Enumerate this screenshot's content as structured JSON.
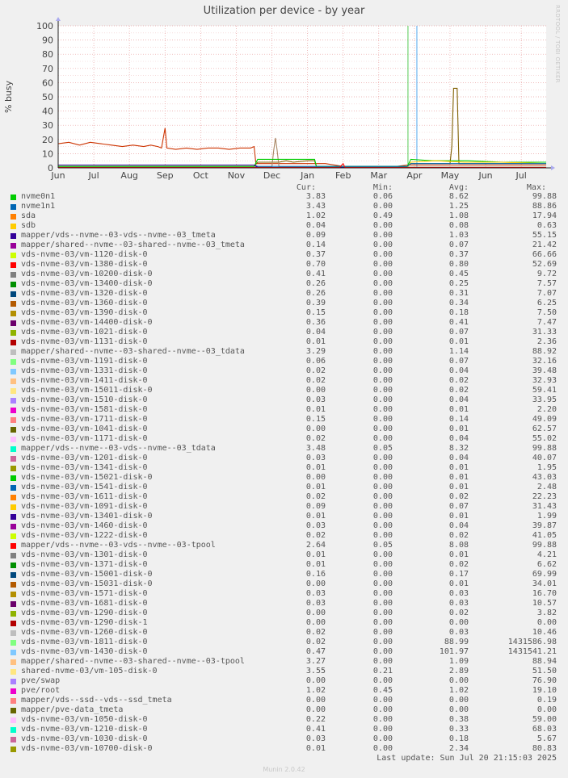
{
  "title": "Utilization per device - by year",
  "watermark": "RRDTOOL / TOBI OETIKER",
  "footer": "Munin 2.0.42",
  "last_update": "Last update: Sun Jul 20 21:15:03 2025",
  "columns": [
    "Cur:",
    "Min:",
    "Avg:",
    "Max:"
  ],
  "chart_data": {
    "type": "line",
    "title": "Utilization per device - by year",
    "ylabel": "% busy",
    "ylim": [
      0,
      100
    ],
    "yticks": [
      0,
      10,
      20,
      30,
      40,
      50,
      60,
      70,
      80,
      90,
      100
    ],
    "xticks": [
      "Jun",
      "Jul",
      "Aug",
      "Sep",
      "Oct",
      "Nov",
      "Dec",
      "Jan",
      "Feb",
      "Mar",
      "Apr",
      "May",
      "Jun",
      "Jul"
    ],
    "xrange": [
      0,
      13.7
    ],
    "grid": true,
    "vlines": [
      {
        "x": 9.82,
        "color": "#55cc55"
      },
      {
        "x": 10.07,
        "color": "#55aaee"
      }
    ],
    "series": [
      {
        "name": "mapper/vds--nvme--03-vds--nvme--03_tdata",
        "color": "#cc3300",
        "points": [
          [
            0,
            17
          ],
          [
            0.3,
            18
          ],
          [
            0.6,
            16
          ],
          [
            0.9,
            18
          ],
          [
            1.2,
            17
          ],
          [
            1.5,
            16
          ],
          [
            1.8,
            15
          ],
          [
            2.1,
            16
          ],
          [
            2.4,
            15
          ],
          [
            2.6,
            16
          ],
          [
            2.8,
            15
          ],
          [
            2.9,
            14
          ],
          [
            3.0,
            28
          ],
          [
            3.05,
            14
          ],
          [
            3.3,
            13
          ],
          [
            3.6,
            14
          ],
          [
            3.9,
            13
          ],
          [
            4.2,
            14
          ],
          [
            4.5,
            14
          ],
          [
            4.8,
            13
          ],
          [
            5.1,
            14
          ],
          [
            5.4,
            14
          ],
          [
            5.5,
            15
          ],
          [
            5.55,
            3
          ],
          [
            6.5,
            3
          ],
          [
            7.5,
            3
          ],
          [
            8.0,
            1
          ],
          [
            9.5,
            1
          ],
          [
            9.8,
            2
          ],
          [
            10.5,
            2
          ],
          [
            11.0,
            2
          ],
          [
            12.0,
            2
          ],
          [
            13.0,
            2
          ],
          [
            13.7,
            2
          ]
        ]
      },
      {
        "name": "mapper/vds--nvme--03-vds--nvme--03-tpool",
        "color": "#7f5f00",
        "points": [
          [
            0,
            1
          ],
          [
            5.5,
            1
          ],
          [
            5.6,
            4
          ],
          [
            6.0,
            4
          ],
          [
            6.2,
            4
          ],
          [
            6.4,
            5
          ],
          [
            6.6,
            4
          ],
          [
            7.0,
            5
          ],
          [
            7.2,
            5
          ],
          [
            7.25,
            1
          ],
          [
            9.8,
            1
          ],
          [
            9.9,
            3
          ],
          [
            10.3,
            3
          ],
          [
            11.0,
            3
          ],
          [
            11.05,
            15
          ],
          [
            11.1,
            56
          ],
          [
            11.2,
            56
          ],
          [
            11.25,
            3
          ],
          [
            12.0,
            3
          ],
          [
            13.7,
            3
          ]
        ]
      },
      {
        "name": "mapper/shared--nvme--03-shared--nvme--03_tdata",
        "color": "#aa8866",
        "points": [
          [
            0,
            0.5
          ],
          [
            6.0,
            0.5
          ],
          [
            6.05,
            12
          ],
          [
            6.1,
            21
          ],
          [
            6.15,
            12
          ],
          [
            6.2,
            0.5
          ],
          [
            13.7,
            0.5
          ]
        ]
      },
      {
        "name": "nvme0n1",
        "color": "#00cc00",
        "points": [
          [
            0,
            1
          ],
          [
            5.5,
            1
          ],
          [
            5.6,
            6
          ],
          [
            7.2,
            6
          ],
          [
            7.25,
            1
          ],
          [
            9.8,
            1
          ],
          [
            9.9,
            6
          ],
          [
            10.5,
            5
          ],
          [
            11.5,
            5
          ],
          [
            12.5,
            4
          ],
          [
            13.7,
            4
          ]
        ]
      },
      {
        "name": "sdb",
        "color": "#ffcc00",
        "points": [
          [
            0,
            0.3
          ],
          [
            9.8,
            0.3
          ],
          [
            9.9,
            4
          ],
          [
            10.6,
            5
          ],
          [
            11.4,
            4
          ],
          [
            12.4,
            4
          ],
          [
            13.7,
            3
          ]
        ]
      },
      {
        "name": "nvme1n1",
        "color": "#0066b3",
        "points": [
          [
            0,
            2
          ],
          [
            5.5,
            2
          ],
          [
            5.6,
            1
          ],
          [
            9.8,
            1
          ],
          [
            9.9,
            3
          ],
          [
            13.7,
            3
          ]
        ]
      },
      {
        "name": "mapper/vds--nvme--03-vds--nvme--03_tmeta",
        "color": "#330099",
        "points": [
          [
            0,
            2
          ],
          [
            1.5,
            2
          ],
          [
            3.0,
            2
          ],
          [
            4.5,
            2
          ],
          [
            5.5,
            2
          ],
          [
            5.6,
            0.3
          ],
          [
            13.7,
            0.3
          ]
        ]
      },
      {
        "name": "vds-nvme-03/vm-1380-disk-0",
        "color": "#ff0000",
        "points": [
          [
            0,
            0.3
          ],
          [
            7.9,
            0.3
          ],
          [
            8.0,
            3
          ],
          [
            8.05,
            0.3
          ],
          [
            13.7,
            0.3
          ]
        ]
      }
    ]
  },
  "legend": [
    {
      "name": "nvme0n1",
      "color": "#00cc00",
      "cur": "3.83",
      "min": "0.06",
      "avg": "8.62",
      "max": "99.88"
    },
    {
      "name": "nvme1n1",
      "color": "#0066b3",
      "cur": "3.43",
      "min": "0.00",
      "avg": "1.25",
      "max": "88.86"
    },
    {
      "name": "sda",
      "color": "#ff8000",
      "cur": "1.02",
      "min": "0.49",
      "avg": "1.08",
      "max": "17.94"
    },
    {
      "name": "sdb",
      "color": "#ffcc00",
      "cur": "0.04",
      "min": "0.00",
      "avg": "0.08",
      "max": "0.63"
    },
    {
      "name": "mapper/vds--nvme--03-vds--nvme--03_tmeta",
      "color": "#330099",
      "cur": "0.09",
      "min": "0.00",
      "avg": "1.03",
      "max": "55.15"
    },
    {
      "name": "mapper/shared--nvme--03-shared--nvme--03_tmeta",
      "color": "#990099",
      "cur": "0.14",
      "min": "0.00",
      "avg": "0.07",
      "max": "21.42"
    },
    {
      "name": "vds-nvme-03/vm-1120-disk-0",
      "color": "#ccff00",
      "cur": "0.37",
      "min": "0.00",
      "avg": "0.37",
      "max": "66.66"
    },
    {
      "name": "vds-nvme-03/vm-1380-disk-0",
      "color": "#ff0000",
      "cur": "0.70",
      "min": "0.00",
      "avg": "0.80",
      "max": "52.69"
    },
    {
      "name": "vds-nvme-03/vm-10200-disk-0",
      "color": "#808080",
      "cur": "0.41",
      "min": "0.00",
      "avg": "0.45",
      "max": "9.72"
    },
    {
      "name": "vds-nvme-03/vm-13400-disk-0",
      "color": "#008f00",
      "cur": "0.26",
      "min": "0.00",
      "avg": "0.25",
      "max": "7.57"
    },
    {
      "name": "vds-nvme-03/vm-1320-disk-0",
      "color": "#00487d",
      "cur": "0.26",
      "min": "0.00",
      "avg": "0.31",
      "max": "7.07"
    },
    {
      "name": "vds-nvme-03/vm-1360-disk-0",
      "color": "#b35a00",
      "cur": "0.39",
      "min": "0.00",
      "avg": "0.34",
      "max": "6.25"
    },
    {
      "name": "vds-nvme-03/vm-1390-disk-0",
      "color": "#b38f00",
      "cur": "0.15",
      "min": "0.00",
      "avg": "0.18",
      "max": "7.50"
    },
    {
      "name": "vds-nvme-03/vm-14400-disk-0",
      "color": "#6b006b",
      "cur": "0.36",
      "min": "0.00",
      "avg": "0.41",
      "max": "7.47"
    },
    {
      "name": "vds-nvme-03/vm-1021-disk-0",
      "color": "#8fb300",
      "cur": "0.04",
      "min": "0.00",
      "avg": "0.07",
      "max": "31.33"
    },
    {
      "name": "vds-nvme-03/vm-1131-disk-0",
      "color": "#b30000",
      "cur": "0.01",
      "min": "0.00",
      "avg": "0.01",
      "max": "2.36"
    },
    {
      "name": "mapper/shared--nvme--03-shared--nvme--03_tdata",
      "color": "#bebebe",
      "cur": "3.29",
      "min": "0.00",
      "avg": "1.14",
      "max": "88.92"
    },
    {
      "name": "vds-nvme-03/vm-1191-disk-0",
      "color": "#80ff80",
      "cur": "0.06",
      "min": "0.00",
      "avg": "0.07",
      "max": "32.16"
    },
    {
      "name": "vds-nvme-03/vm-1331-disk-0",
      "color": "#80c9ff",
      "cur": "0.02",
      "min": "0.00",
      "avg": "0.04",
      "max": "39.48"
    },
    {
      "name": "vds-nvme-03/vm-1411-disk-0",
      "color": "#ffc080",
      "cur": "0.02",
      "min": "0.00",
      "avg": "0.02",
      "max": "32.93"
    },
    {
      "name": "vds-nvme-03/vm-15011-disk-0",
      "color": "#ffe680",
      "cur": "0.00",
      "min": "0.00",
      "avg": "0.02",
      "max": "59.41"
    },
    {
      "name": "vds-nvme-03/vm-1510-disk-0",
      "color": "#aa80ff",
      "cur": "0.03",
      "min": "0.00",
      "avg": "0.04",
      "max": "33.95"
    },
    {
      "name": "vds-nvme-03/vm-1581-disk-0",
      "color": "#ee00cc",
      "cur": "0.01",
      "min": "0.00",
      "avg": "0.01",
      "max": "2.20"
    },
    {
      "name": "vds-nvme-03/vm-1711-disk-0",
      "color": "#ff8080",
      "cur": "0.15",
      "min": "0.00",
      "avg": "0.14",
      "max": "49.09"
    },
    {
      "name": "vds-nvme-03/vm-1041-disk-0",
      "color": "#666600",
      "cur": "0.00",
      "min": "0.00",
      "avg": "0.01",
      "max": "62.57"
    },
    {
      "name": "vds-nvme-03/vm-1171-disk-0",
      "color": "#ffbfff",
      "cur": "0.02",
      "min": "0.00",
      "avg": "0.04",
      "max": "55.02"
    },
    {
      "name": "mapper/vds--nvme--03-vds--nvme--03_tdata",
      "color": "#00ffcc",
      "cur": "3.48",
      "min": "0.05",
      "avg": "8.32",
      "max": "99.88"
    },
    {
      "name": "vds-nvme-03/vm-1201-disk-0",
      "color": "#cc6699",
      "cur": "0.03",
      "min": "0.00",
      "avg": "0.04",
      "max": "40.07"
    },
    {
      "name": "vds-nvme-03/vm-1341-disk-0",
      "color": "#999900",
      "cur": "0.01",
      "min": "0.00",
      "avg": "0.01",
      "max": "1.95"
    },
    {
      "name": "vds-nvme-03/vm-15021-disk-0",
      "color": "#00cc00",
      "cur": "0.00",
      "min": "0.00",
      "avg": "0.01",
      "max": "43.03"
    },
    {
      "name": "vds-nvme-03/vm-1541-disk-0",
      "color": "#0066b3",
      "cur": "0.01",
      "min": "0.00",
      "avg": "0.01",
      "max": "2.48"
    },
    {
      "name": "vds-nvme-03/vm-1611-disk-0",
      "color": "#ff8000",
      "cur": "0.02",
      "min": "0.00",
      "avg": "0.02",
      "max": "22.23"
    },
    {
      "name": "vds-nvme-03/vm-1091-disk-0",
      "color": "#ffcc00",
      "cur": "0.09",
      "min": "0.00",
      "avg": "0.07",
      "max": "31.43"
    },
    {
      "name": "vds-nvme-03/vm-13401-disk-0",
      "color": "#330099",
      "cur": "0.01",
      "min": "0.00",
      "avg": "0.01",
      "max": "1.99"
    },
    {
      "name": "vds-nvme-03/vm-1460-disk-0",
      "color": "#990099",
      "cur": "0.03",
      "min": "0.00",
      "avg": "0.04",
      "max": "39.87"
    },
    {
      "name": "vds-nvme-03/vm-1222-disk-0",
      "color": "#ccff00",
      "cur": "0.02",
      "min": "0.00",
      "avg": "0.02",
      "max": "41.05"
    },
    {
      "name": "mapper/vds--nvme--03-vds--nvme--03-tpool",
      "color": "#ff0000",
      "cur": "2.64",
      "min": "0.05",
      "avg": "8.08",
      "max": "99.88"
    },
    {
      "name": "vds-nvme-03/vm-1301-disk-0",
      "color": "#808080",
      "cur": "0.01",
      "min": "0.00",
      "avg": "0.01",
      "max": "4.21"
    },
    {
      "name": "vds-nvme-03/vm-1371-disk-0",
      "color": "#008f00",
      "cur": "0.01",
      "min": "0.00",
      "avg": "0.02",
      "max": "6.62"
    },
    {
      "name": "vds-nvme-03/vm-15001-disk-0",
      "color": "#00487d",
      "cur": "0.16",
      "min": "0.00",
      "avg": "0.17",
      "max": "69.99"
    },
    {
      "name": "vds-nvme-03/vm-15031-disk-0",
      "color": "#b35a00",
      "cur": "0.00",
      "min": "0.00",
      "avg": "0.01",
      "max": "34.01"
    },
    {
      "name": "vds-nvme-03/vm-1571-disk-0",
      "color": "#b38f00",
      "cur": "0.03",
      "min": "0.00",
      "avg": "0.03",
      "max": "16.70"
    },
    {
      "name": "vds-nvme-03/vm-1681-disk-0",
      "color": "#6b006b",
      "cur": "0.03",
      "min": "0.00",
      "avg": "0.03",
      "max": "10.57"
    },
    {
      "name": "vds-nvme-03/vm-1290-disk-0",
      "color": "#8fb300",
      "cur": "0.00",
      "min": "0.00",
      "avg": "0.02",
      "max": "3.82"
    },
    {
      "name": "vds-nvme-03/vm-1290-disk-1",
      "color": "#b30000",
      "cur": "0.00",
      "min": "0.00",
      "avg": "0.00",
      "max": "0.00"
    },
    {
      "name": "vds-nvme-03/vm-1260-disk-0",
      "color": "#bebebe",
      "cur": "0.02",
      "min": "0.00",
      "avg": "0.03",
      "max": "10.46"
    },
    {
      "name": "vds-nvme-03/vm-1811-disk-0",
      "color": "#80ff80",
      "cur": "0.02",
      "min": "0.00",
      "avg": "88.99",
      "max": "1431586.98"
    },
    {
      "name": "vds-nvme-03/vm-1430-disk-0",
      "color": "#80c9ff",
      "cur": "0.47",
      "min": "0.00",
      "avg": "101.97",
      "max": "1431541.21"
    },
    {
      "name": "mapper/shared--nvme--03-shared--nvme--03-tpool",
      "color": "#ffc080",
      "cur": "3.27",
      "min": "0.00",
      "avg": "1.09",
      "max": "88.94"
    },
    {
      "name": "shared-nvme-03/vm-105-disk-0",
      "color": "#ffe680",
      "cur": "3.55",
      "min": "0.21",
      "avg": "2.89",
      "max": "51.50"
    },
    {
      "name": "pve/swap",
      "color": "#aa80ff",
      "cur": "0.00",
      "min": "0.00",
      "avg": "0.00",
      "max": "76.90"
    },
    {
      "name": "pve/root",
      "color": "#ee00cc",
      "cur": "1.02",
      "min": "0.45",
      "avg": "1.02",
      "max": "19.10"
    },
    {
      "name": "mapper/vds--ssd--vds--ssd_tmeta",
      "color": "#ff8080",
      "cur": "0.00",
      "min": "0.00",
      "avg": "0.00",
      "max": "0.19"
    },
    {
      "name": "mapper/pve-data_tmeta",
      "color": "#666600",
      "cur": "0.00",
      "min": "0.00",
      "avg": "0.00",
      "max": "0.00"
    },
    {
      "name": "vds-nvme-03/vm-1050-disk-0",
      "color": "#ffbfff",
      "cur": "0.22",
      "min": "0.00",
      "avg": "0.38",
      "max": "59.00"
    },
    {
      "name": "vds-nvme-03/vm-1210-disk-0",
      "color": "#00ffcc",
      "cur": "0.41",
      "min": "0.00",
      "avg": "0.33",
      "max": "68.03"
    },
    {
      "name": "vds-nvme-03/vm-1030-disk-0",
      "color": "#cc6699",
      "cur": "0.03",
      "min": "0.00",
      "avg": "0.18",
      "max": "5.67"
    },
    {
      "name": "vds-nvme-03/vm-10700-disk-0",
      "color": "#999900",
      "cur": "0.01",
      "min": "0.00",
      "avg": "2.34",
      "max": "80.83"
    }
  ]
}
